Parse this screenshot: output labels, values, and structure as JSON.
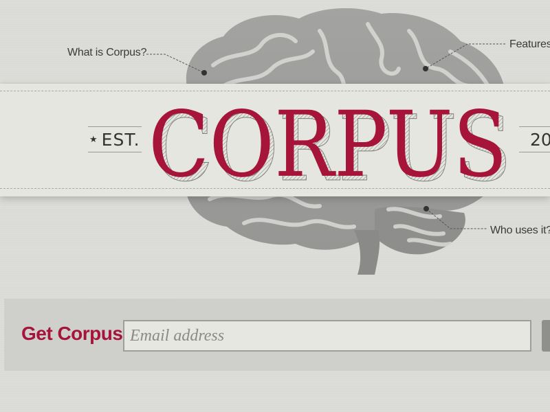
{
  "brand": {
    "name": "CORPUS",
    "est_label": "EST.",
    "year_label": "20",
    "brand_color": "#a6143a"
  },
  "callouts": {
    "what": "What is Corpus?",
    "features": "Features",
    "who": "Who uses it?"
  },
  "signup": {
    "label": "Get Corpus",
    "email_placeholder": "Email address"
  },
  "icons": {
    "star": "star-icon",
    "brain": "brain-illustration"
  }
}
